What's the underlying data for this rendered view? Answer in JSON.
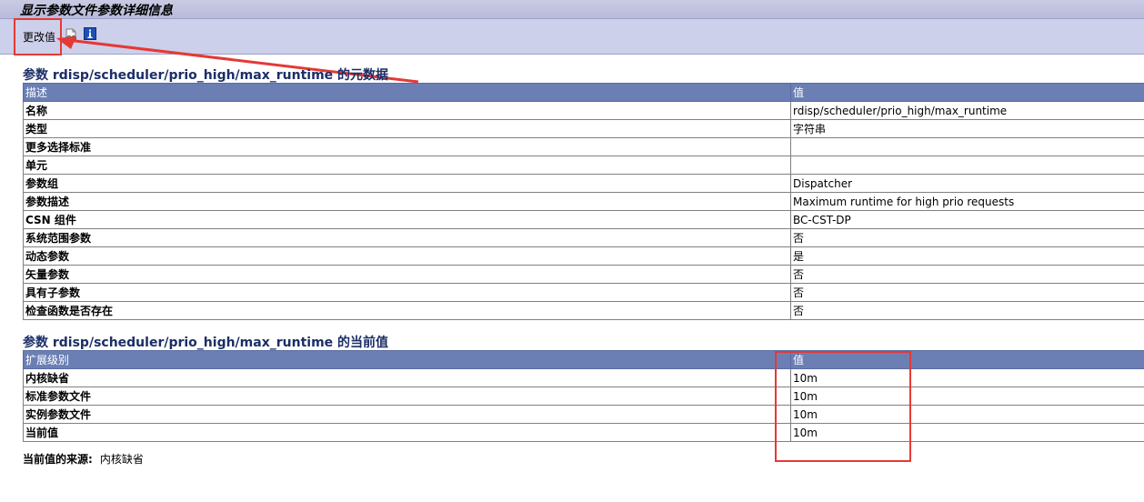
{
  "window": {
    "title": "显示参数文件参数详细信息"
  },
  "toolbar": {
    "change_value_label": "更改值"
  },
  "metadata": {
    "title": "参数 rdisp/scheduler/prio_high/max_runtime 的元数据",
    "header": {
      "col1": "描述",
      "col2": "值"
    },
    "rows": [
      {
        "label": "名称",
        "value": "rdisp/scheduler/prio_high/max_runtime"
      },
      {
        "label": "类型",
        "value": "字符串"
      },
      {
        "label": "更多选择标准",
        "value": ""
      },
      {
        "label": "单元",
        "value": ""
      },
      {
        "label": "参数组",
        "value": "Dispatcher"
      },
      {
        "label": "参数描述",
        "value": "Maximum runtime for high prio requests"
      },
      {
        "label": "CSN 组件",
        "value": "BC-CST-DP"
      },
      {
        "label": "系统范围参数",
        "value": "否"
      },
      {
        "label": "动态参数",
        "value": "是"
      },
      {
        "label": "矢量参数",
        "value": "否"
      },
      {
        "label": "具有子参数",
        "value": "否"
      },
      {
        "label": "检查函数是否存在",
        "value": "否"
      }
    ]
  },
  "current": {
    "title": "参数 rdisp/scheduler/prio_high/max_runtime 的当前值",
    "header": {
      "col1": "扩展级别",
      "col2": "值"
    },
    "rows": [
      {
        "label": "内核缺省",
        "value": "10m"
      },
      {
        "label": "标准参数文件",
        "value": "10m"
      },
      {
        "label": "实例参数文件",
        "value": "10m"
      },
      {
        "label": "当前值",
        "value": "10m"
      }
    ],
    "source_label": "当前值的来源:",
    "source_value": "内核缺省"
  },
  "colors": {
    "header_bg": "#6b7fb5",
    "highlight": "#e53935",
    "title_text": "#1b2e66"
  }
}
